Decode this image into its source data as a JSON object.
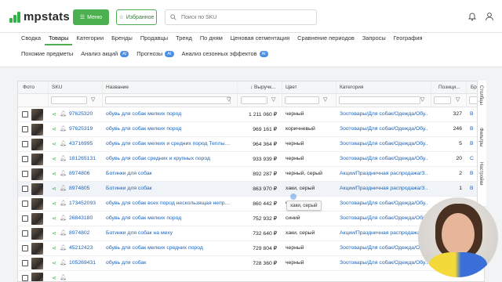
{
  "header": {
    "logo_text": "mpstats",
    "menu_label": "Меню",
    "favorites_label": "Избранное",
    "search_placeholder": "Поиск по SKU"
  },
  "tabs_row1": [
    "Сводка",
    "Товары",
    "Категории",
    "Бренды",
    "Продавцы",
    "Тренд",
    "По дням",
    "Ценовая сегментация",
    "Сравнение периодов",
    "Запросы",
    "География"
  ],
  "active_tab": "Товары",
  "tabs_row2": [
    {
      "label": "Похожие предметы",
      "ai": ""
    },
    {
      "label": "Анализ акций",
      "ai": "AI"
    },
    {
      "label": "Прогнозы",
      "ai": "AI"
    },
    {
      "label": "Анализ сезонных эффектов",
      "ai": "AI"
    }
  ],
  "table": {
    "columns": {
      "photo": "Фото",
      "sku": "SKU",
      "name": "Название",
      "revenue": "↓ Выручк...",
      "color": "Цвет",
      "category": "Категория",
      "position": "Позици...",
      "brand": "Бре"
    },
    "rows": [
      {
        "sku": "97625320",
        "name": "обувь для собак мелких пород",
        "revenue": "1 211 060 ₽",
        "color": "черный",
        "category": "Зоотовары/Для собак/Одежда/Обу...",
        "position": "327",
        "brand": "B"
      },
      {
        "sku": "97625319",
        "name": "обувь для собак мелких пород",
        "revenue": "969 161 ₽",
        "color": "коричневый",
        "category": "Зоотовары/Для собак/Одежда/Обу...",
        "position": "246",
        "brand": "B"
      },
      {
        "sku": "43716995",
        "name": "обувь для собак мелких и средних пород Теплые са...",
        "revenue": "964 364 ₽",
        "color": "черный",
        "category": "Зоотовары/Для собак/Одежда/Обу...",
        "position": "5",
        "brand": "B"
      },
      {
        "sku": "181265131",
        "name": "обувь для собак средних и крупных пород",
        "revenue": "933 939 ₽",
        "color": "черный",
        "category": "Зоотовары/Для собак/Одежда/Обу...",
        "position": "20",
        "brand": "C"
      },
      {
        "sku": "8974806",
        "name": "Ботинки для собак",
        "revenue": "892 287 ₽",
        "color": "черный, серый",
        "category": "Акции/Праздничная распродажа/З...",
        "position": "2",
        "brand": "B"
      },
      {
        "sku": "8974805",
        "name": "Ботинки для собак",
        "revenue": "863 970 ₽",
        "color": "хаки, серый",
        "category": "Акции/Праздничная распродажа/З...",
        "position": "1",
        "brand": "B"
      },
      {
        "sku": "173452093",
        "name": "обувь для собак всех пород нескользящая непромок...",
        "revenue": "860 442 ₽",
        "color": "че",
        "category": "Зоотовары/Для собак/Одежда/Обу...",
        "position": "",
        "brand": ""
      },
      {
        "sku": "26843180",
        "name": "обувь для собак мелких пород",
        "revenue": "752 932 ₽",
        "color": "синий",
        "category": "Зоотовары/Для собак/Одежда/Обу...",
        "position": "",
        "brand": ""
      },
      {
        "sku": "8974802",
        "name": "Ботинки для собак на меху",
        "revenue": "732 640 ₽",
        "color": "хаки, серый",
        "category": "Акции/Праздничная распродажа/З...",
        "position": "",
        "brand": ""
      },
      {
        "sku": "45212423",
        "name": "обувь для собак мелких средних пород",
        "revenue": "729 804 ₽",
        "color": "черный",
        "category": "Зоотовары/Для собак/Одежда/Обу...",
        "position": "",
        "brand": ""
      },
      {
        "sku": "105269431",
        "name": "обувь для собак",
        "revenue": "728 360 ₽",
        "color": "черный",
        "category": "Зоотовары/Для собак/Одежда/Обу...",
        "position": "",
        "brand": ""
      },
      {
        "sku": "",
        "name": "",
        "revenue": "",
        "color": "",
        "category": "",
        "position": "",
        "brand": ""
      }
    ]
  },
  "tooltip": "хаки, серый",
  "side_panel": [
    "Столбцы",
    "Фильтры",
    "Настройки"
  ]
}
